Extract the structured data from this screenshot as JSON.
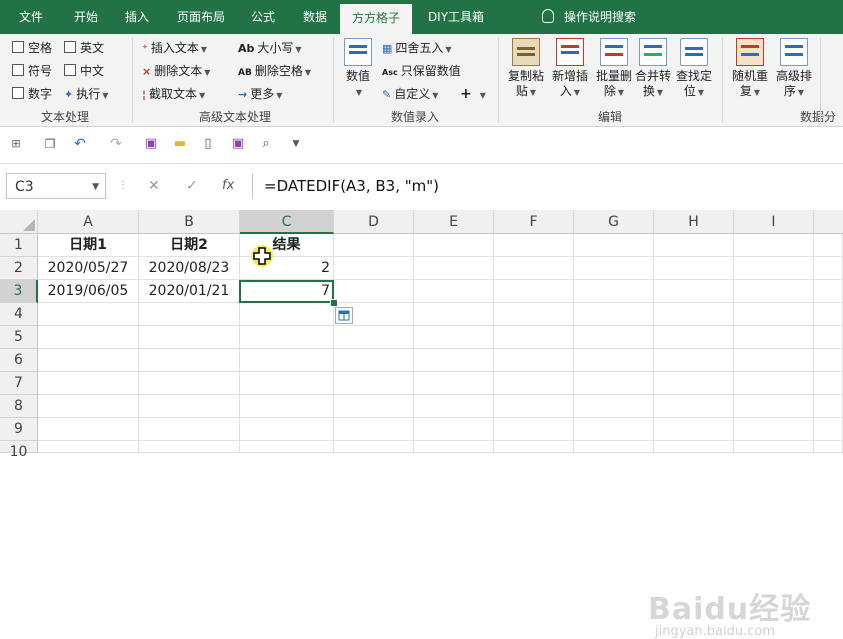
{
  "tabs": [
    {
      "label": "文件",
      "active": false
    },
    {
      "label": "开始",
      "active": false
    },
    {
      "label": "插入",
      "active": false
    },
    {
      "label": "页面布局",
      "active": false
    },
    {
      "label": "公式",
      "active": false
    },
    {
      "label": "数据",
      "active": false
    },
    {
      "label": "方方格子",
      "active": true
    },
    {
      "label": "DIY工具箱",
      "active": false
    }
  ],
  "tell_me": "操作说明搜索",
  "ribbon": {
    "text_processing": {
      "items": [
        "空格",
        "英文",
        "符号",
        "中文",
        "数字",
        "执行"
      ],
      "label": "文本处理"
    },
    "advanced_text": {
      "items": [
        "插入文本",
        "删除文本",
        "截取文本",
        "大小写",
        "删除空格",
        "更多"
      ],
      "label": "高级文本处理"
    },
    "number_entry": {
      "big_button": "数值",
      "items": [
        "四舍五入",
        "只保留数值",
        "自定义"
      ],
      "label": "数值录入"
    },
    "edit": {
      "buttons": [
        {
          "line1": "复制粘",
          "line2": "贴"
        },
        {
          "line1": "新增插",
          "line2": "入"
        },
        {
          "line1": "批量删",
          "line2": "除"
        },
        {
          "line1": "合并转",
          "line2": "换"
        },
        {
          "line1": "查找定",
          "line2": "位"
        }
      ],
      "label": "编辑"
    },
    "data_analysis": {
      "buttons": [
        {
          "line1": "随机重",
          "line2": "复"
        },
        {
          "line1": "高级排",
          "line2": "序"
        }
      ],
      "label": "数据分"
    }
  },
  "formula_bar": {
    "name_box": "C3",
    "formula": "=DATEDIF(A3, B3, \"m\")"
  },
  "columns": [
    "A",
    "B",
    "C",
    "D",
    "E",
    "F",
    "G",
    "H",
    "I"
  ],
  "rows": [
    "1",
    "2",
    "3",
    "4",
    "5",
    "6",
    "7",
    "8",
    "9",
    "10"
  ],
  "cells": {
    "A1": "日期1",
    "B1": "日期2",
    "C1": "结果",
    "A2": "2020/05/27",
    "B2": "2020/08/23",
    "C2": "2",
    "A3": "2019/06/05",
    "B3": "2020/01/21",
    "C3": "7"
  },
  "watermark": "Baidu经验",
  "watermark_sub": "jingyan.baidu.com",
  "colors": {
    "accent": "#217346"
  }
}
